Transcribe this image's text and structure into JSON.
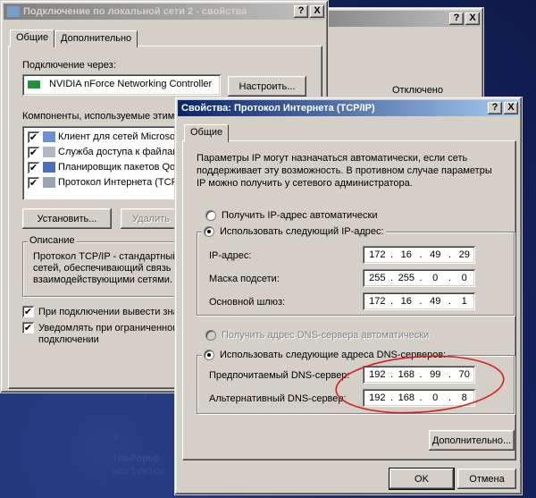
{
  "desktop": {
    "watermark1": "thePopup.",
    "watermark2": "worldwide"
  },
  "bg_window": {
    "title": "Отключено",
    "label": "Отключено"
  },
  "main_window": {
    "title": "Подключение по локальной сети 2 - свойства",
    "help_btn": "?",
    "close_btn": "X",
    "tabs": [
      "Общие",
      "Дополнительно"
    ],
    "connect_via": "Подключение через:",
    "adapter": "NVIDIA nForce Networking Controller",
    "configure_btn": "Настроить...",
    "components_label": "Компоненты, используемые этим",
    "components": [
      {
        "label": "Клиент для сетей Microsoft",
        "checked": true
      },
      {
        "label": "Служба доступа к файлам",
        "checked": true
      },
      {
        "label": "Планировщик пакетов QoS",
        "checked": true
      },
      {
        "label": "Протокол Интернета (TCP/IP)",
        "checked": true
      }
    ],
    "install_btn": "Установить...",
    "remove_btn": "Удалить",
    "description_title": "Описание",
    "description_lines": [
      "Протокол TCP/IP - стандартный",
      "сетей, обеспечивающий связь",
      "взаимодействующими сетями."
    ],
    "show_icon_label": "При подключении вывести зна",
    "notify_label1": "Уведомлять при ограниченном",
    "notify_label2": "подключении"
  },
  "tcp_dialog": {
    "title": "Свойства: Протокол Интернета (TCP/IP)",
    "help_btn": "?",
    "close_btn": "X",
    "tab": "Общие",
    "intro_lines": [
      "Параметры IP могут назначаться автоматически, если сеть",
      "поддерживает эту возможность. В противном случае параметры",
      "IP можно получить у сетевого администратора."
    ],
    "auto_ip": "Получить IP-адрес автоматически",
    "manual_ip": "Использовать следующий IP-адрес:",
    "ip_label": "IP-адрес:",
    "ip_value": [
      "172",
      "16",
      "49",
      "29"
    ],
    "mask_label": "Маска подсети:",
    "mask_value": [
      "255",
      "255",
      "0",
      "0"
    ],
    "gw_label": "Основной шлюз:",
    "gw_value": [
      "172",
      "16",
      "49",
      "1"
    ],
    "auto_dns": "Получить адрес DNS-сервера автоматически",
    "manual_dns": "Использовать следующие адреса DNS-серверов:",
    "dns1_label": "Предпочитаемый DNS-сервер:",
    "dns1_value": [
      "192",
      "168",
      "99",
      "70"
    ],
    "dns2_label": "Альтернативный DNS-сервер:",
    "dns2_value": [
      "192",
      "168",
      "0",
      "8"
    ],
    "advanced_btn": "Дополнительно...",
    "ok_btn": "OK",
    "cancel_btn": "Отмена"
  },
  "colors": {
    "highlight_ellipse": "#d42020",
    "active_title": "#0a246a"
  }
}
